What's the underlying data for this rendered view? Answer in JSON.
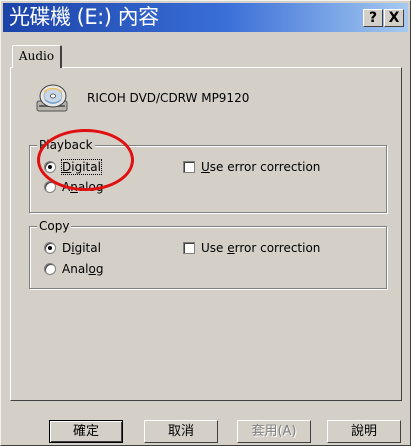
{
  "window": {
    "title": "光碟機 (E:) 內容",
    "help_button": "?",
    "close_button": "X"
  },
  "tabs": [
    {
      "label": "Audio"
    }
  ],
  "device": {
    "icon": "cd-drive-icon",
    "name": "RICOH DVD/CDRW MP9120"
  },
  "playback": {
    "group_label": "Playback",
    "options": [
      {
        "prefix": "",
        "accel": "D",
        "rest": "igital",
        "selected": true
      },
      {
        "prefix": "A",
        "accel": "n",
        "rest": "alog",
        "selected": false
      }
    ],
    "error_correction": {
      "prefix": "",
      "accel": "U",
      "rest": "se error correction",
      "checked": false
    }
  },
  "copy": {
    "group_label": "Copy",
    "options": [
      {
        "prefix": "D",
        "accel": "i",
        "rest": "gital",
        "selected": true
      },
      {
        "prefix": "Anal",
        "accel": "o",
        "rest": "g",
        "selected": false
      }
    ],
    "error_correction": {
      "prefix": "Use ",
      "accel": "e",
      "rest": "rror correction",
      "checked": false
    }
  },
  "annotation": {
    "color": "#e01010"
  },
  "buttons": {
    "ok": "確定",
    "cancel": "取消",
    "apply": "套用(A)",
    "help": "說明"
  },
  "colors": {
    "dialog_bg": "#d4d0c8",
    "titlebar_start": "#1b43a8",
    "titlebar_end": "#a6caf0"
  }
}
